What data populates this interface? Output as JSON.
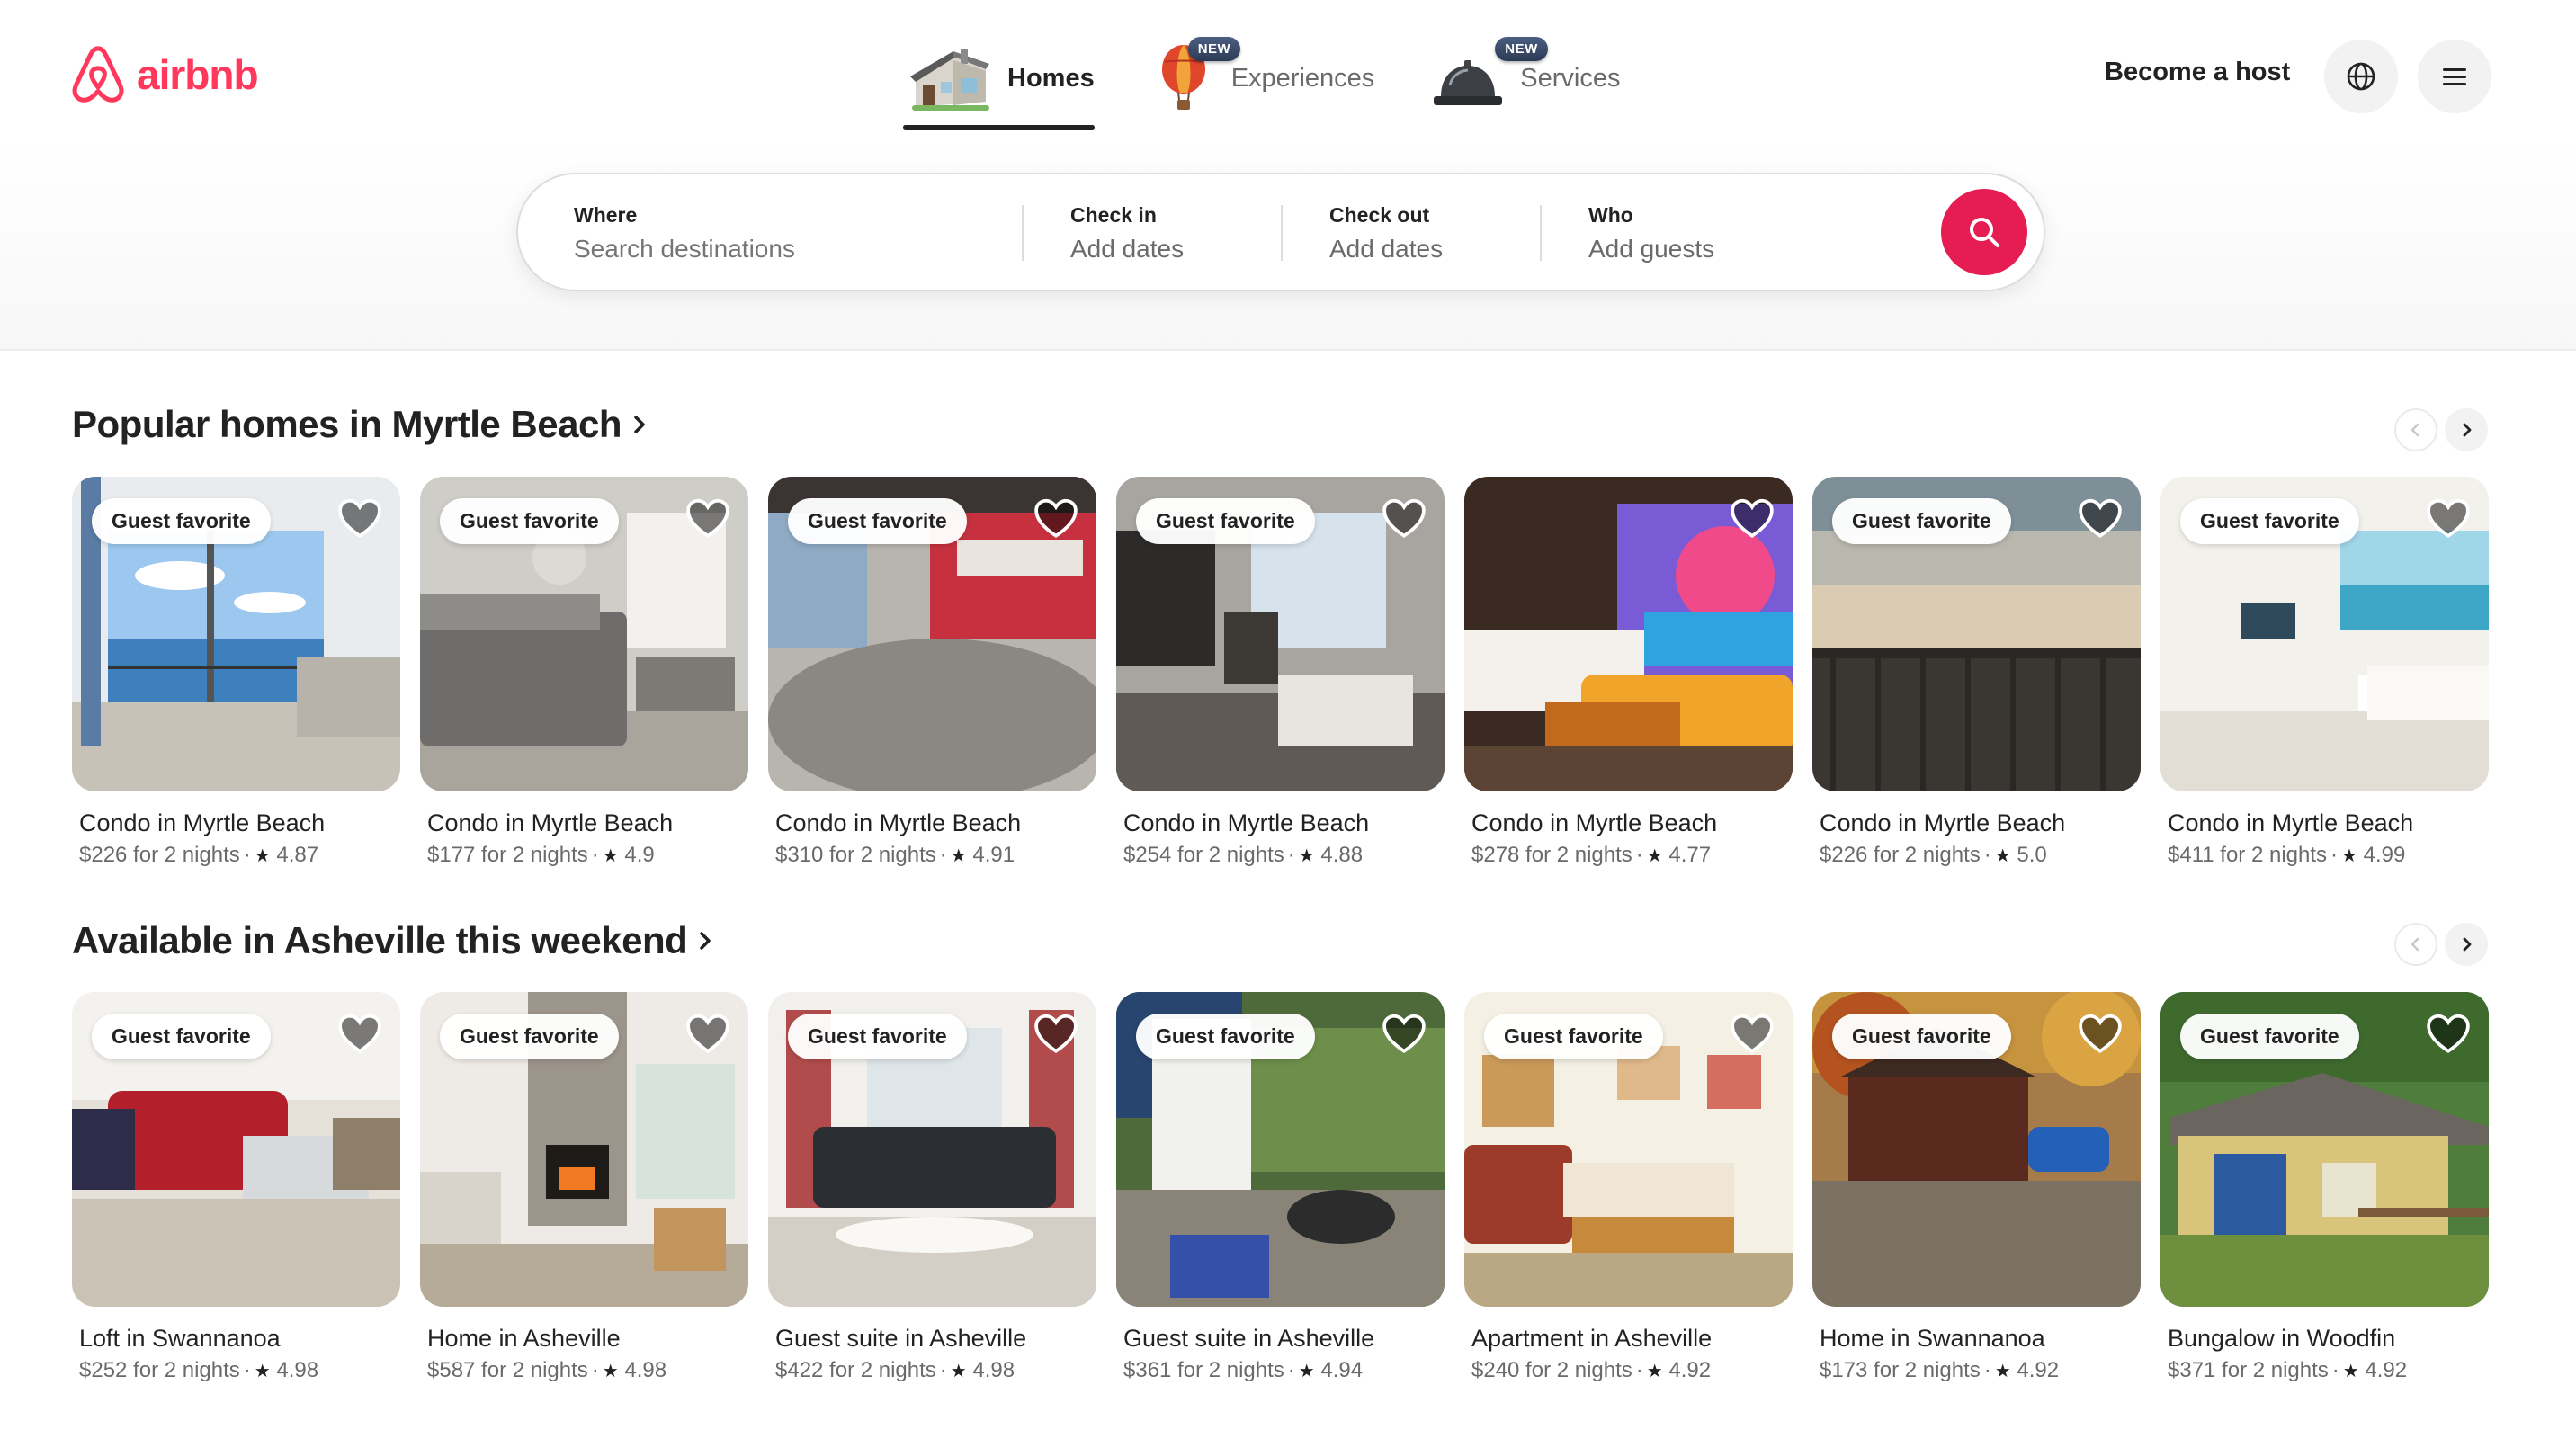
{
  "brand": {
    "name": "airbnb",
    "color": "#ff385c"
  },
  "nav": {
    "tabs": [
      {
        "label": "Homes",
        "icon": "house-icon",
        "badge": "",
        "active": true
      },
      {
        "label": "Experiences",
        "icon": "hot-air-balloon-icon",
        "badge": "NEW",
        "active": false
      },
      {
        "label": "Services",
        "icon": "service-bell-icon",
        "badge": "NEW",
        "active": false
      }
    ],
    "host_label": "Become a host",
    "globe_icon": "globe-icon",
    "menu_icon": "hamburger-menu-icon"
  },
  "search": {
    "where_label": "Where",
    "where_placeholder": "Search destinations",
    "checkin_label": "Check in",
    "checkin_value": "Add dates",
    "checkout_label": "Check out",
    "checkout_value": "Add dates",
    "who_label": "Who",
    "who_value": "Add guests",
    "button_icon": "search-icon",
    "button_color": "#e51d53"
  },
  "sections": [
    {
      "title": "Popular homes in Myrtle Beach",
      "listings": [
        {
          "badge": "Guest favorite",
          "title": "Condo in Myrtle Beach",
          "price": "$226 for 2 nights",
          "rating": "4.87"
        },
        {
          "badge": "Guest favorite",
          "title": "Condo in Myrtle Beach",
          "price": "$177 for 2 nights",
          "rating": "4.9"
        },
        {
          "badge": "Guest favorite",
          "title": "Condo in Myrtle Beach",
          "price": "$310 for 2 nights",
          "rating": "4.91"
        },
        {
          "badge": "Guest favorite",
          "title": "Condo in Myrtle Beach",
          "price": "$254 for 2 nights",
          "rating": "4.88"
        },
        {
          "badge": "",
          "title": "Condo in Myrtle Beach",
          "price": "$278 for 2 nights",
          "rating": "4.77"
        },
        {
          "badge": "Guest favorite",
          "title": "Condo in Myrtle Beach",
          "price": "$226 for 2 nights",
          "rating": "5.0"
        },
        {
          "badge": "Guest favorite",
          "title": "Condo in Myrtle Beach",
          "price": "$411 for 2 nights",
          "rating": "4.99"
        }
      ]
    },
    {
      "title": "Available in Asheville this weekend",
      "listings": [
        {
          "badge": "Guest favorite",
          "title": "Loft in Swannanoa",
          "price": "$252 for 2 nights",
          "rating": "4.98"
        },
        {
          "badge": "Guest favorite",
          "title": "Home in Asheville",
          "price": "$587 for 2 nights",
          "rating": "4.98"
        },
        {
          "badge": "Guest favorite",
          "title": "Guest suite in Asheville",
          "price": "$422 for 2 nights",
          "rating": "4.98"
        },
        {
          "badge": "Guest favorite",
          "title": "Guest suite in Asheville",
          "price": "$361 for 2 nights",
          "rating": "4.94"
        },
        {
          "badge": "Guest favorite",
          "title": "Apartment in Asheville",
          "price": "$240 for 2 nights",
          "rating": "4.92"
        },
        {
          "badge": "Guest favorite",
          "title": "Home in Swannanoa",
          "price": "$173 for 2 nights",
          "rating": "4.92"
        },
        {
          "badge": "Guest favorite",
          "title": "Bungalow in Woodfin",
          "price": "$371 for 2 nights",
          "rating": "4.92"
        }
      ]
    }
  ]
}
